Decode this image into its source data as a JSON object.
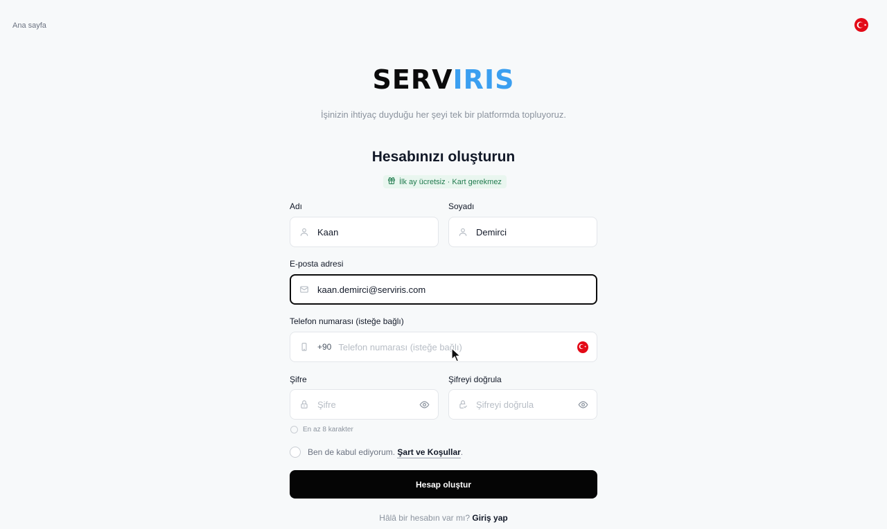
{
  "nav": {
    "home_label": "Ana sayfa"
  },
  "brand": {
    "part1": "SERV",
    "part2": "IRIS",
    "tagline": "İşinizin ihtiyaç duyduğu her şeyi tek bir platformda topluyoruz."
  },
  "form": {
    "title": "Hesabınızı oluşturun",
    "badge": "İlk ay ücretsiz · Kart gerekmez",
    "first_name": {
      "label": "Adı",
      "value": "Kaan"
    },
    "last_name": {
      "label": "Soyadı",
      "value": "Demirci"
    },
    "email": {
      "label": "E-posta adresi",
      "value": "kaan.demirci@serviris.com"
    },
    "phone": {
      "label": "Telefon numarası (isteğe bağlı)",
      "prefix": "+90",
      "placeholder": "Telefon numarası (isteğe bağlı)"
    },
    "password": {
      "label": "Şifre",
      "placeholder": "Şifre"
    },
    "confirm_password": {
      "label": "Şifreyi doğrula",
      "placeholder": "Şifreyi doğrula"
    },
    "password_hint": "En az 8 karakter",
    "terms": {
      "prefix": "Ben de kabul ediyorum.",
      "link": "Şart ve Koşullar",
      "suffix": "."
    },
    "submit_label": "Hesap oluştur",
    "login_prompt": "Hâlâ bir hesabın var mı?",
    "login_link": "Giriş yap"
  },
  "colors": {
    "brand_dark": "#0b0b0b",
    "brand_blue": "#3b9ff0",
    "badge_bg": "#e9f6ef",
    "badge_text": "#1f7a4d",
    "button_bg": "#050505",
    "flag_red": "#e30a17"
  },
  "icons": [
    "turkey-flag-icon",
    "gift-icon",
    "user-icon",
    "mail-icon",
    "phone-icon",
    "lock-icon",
    "eye-icon",
    "lock-check-icon"
  ]
}
